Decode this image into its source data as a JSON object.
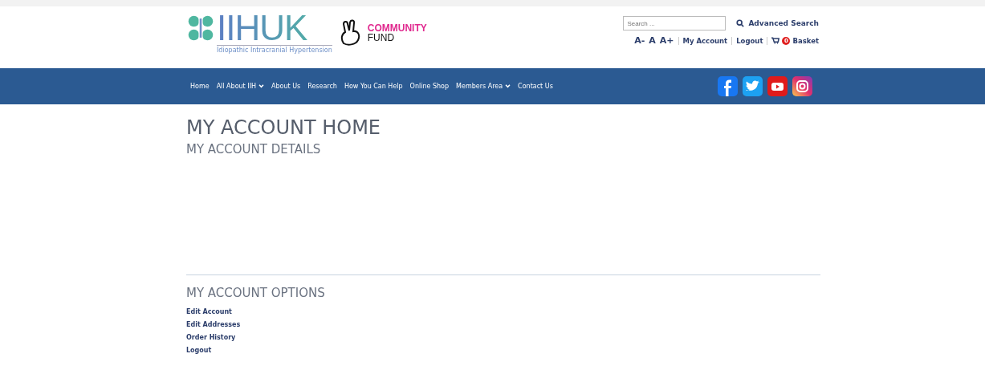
{
  "logo": {
    "wordmark": "IIHUK",
    "tagline": "Idiopathic Intracranial Hypertension"
  },
  "partner_logo": {
    "line_1": "COMMUNITY",
    "line_2": "FUND"
  },
  "search": {
    "placeholder": "Search ...",
    "advanced_link": "Advanced Search"
  },
  "text_size": [
    "A-",
    "A",
    "A+"
  ],
  "account_links": [
    {
      "kind": "link",
      "label": "My Account"
    },
    {
      "kind": "link",
      "label": "Logout"
    },
    {
      "kind": "basket",
      "label": "Basket",
      "count": "0"
    }
  ],
  "nav": [
    {
      "label": "Home",
      "has_dropdown": false
    },
    {
      "label": "All About IIH",
      "has_dropdown": true
    },
    {
      "label": "About Us",
      "has_dropdown": false
    },
    {
      "label": "Research",
      "has_dropdown": false
    },
    {
      "label": "How You Can Help",
      "has_dropdown": false
    },
    {
      "label": "Online Shop",
      "has_dropdown": false
    },
    {
      "label": "Members Area",
      "has_dropdown": true
    },
    {
      "label": "Contact Us",
      "has_dropdown": false
    }
  ],
  "social": [
    {
      "kind": "facebook"
    },
    {
      "kind": "twitter"
    },
    {
      "kind": "youtube"
    },
    {
      "kind": "instagram"
    }
  ],
  "page_title": "MY ACCOUNT HOME",
  "details_heading": "MY ACCOUNT DETAILS",
  "options_heading": "MY ACCOUNT OPTIONS",
  "options": [
    "Edit Account",
    "Edit Addresses",
    "Order History",
    "Logout"
  ]
}
